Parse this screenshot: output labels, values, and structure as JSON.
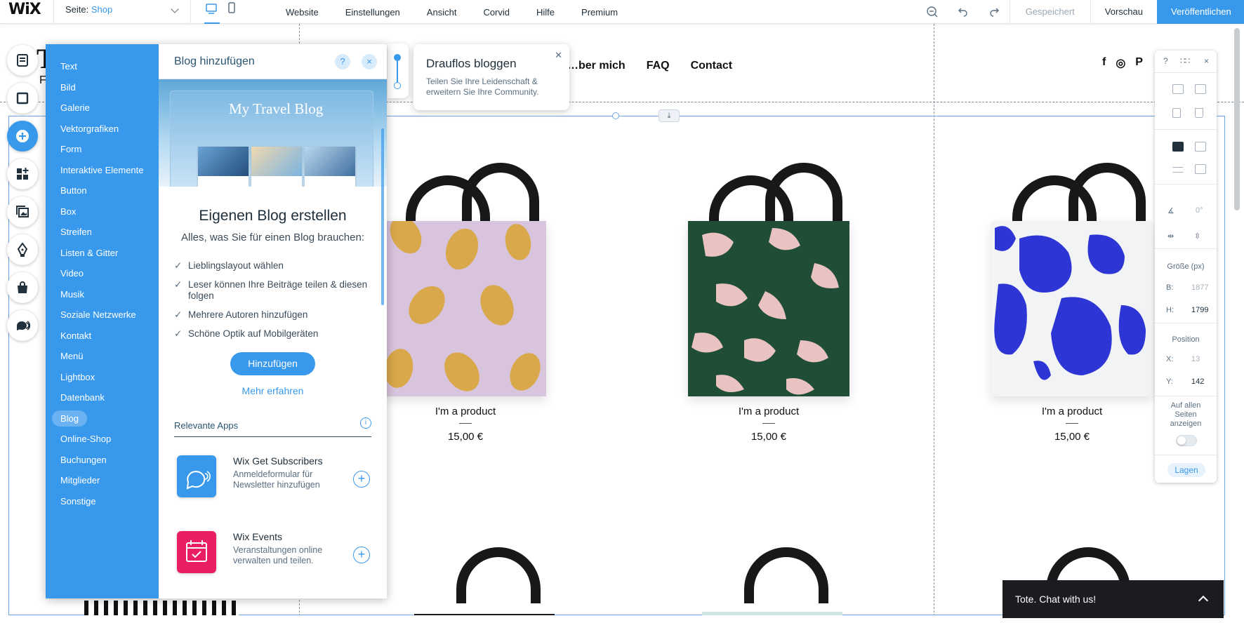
{
  "topbar": {
    "logo": "WiX",
    "page_label": "Seite:",
    "page_value": "Shop",
    "menu": [
      "Website",
      "Einstellungen",
      "Ansicht",
      "Corvid",
      "Hilfe",
      "Premium"
    ],
    "saved": "Gespeichert",
    "preview": "Vorschau",
    "publish": "Veröffentlichen"
  },
  "rail": [
    "pages-icon",
    "background-icon",
    "add-icon",
    "app-market-icon",
    "media-icon",
    "pen-icon",
    "bag-icon",
    "chat-icon"
  ],
  "add_panel": {
    "categories": [
      "Text",
      "Bild",
      "Galerie",
      "Vektorgrafiken",
      "Form",
      "Interaktive Elemente",
      "Button",
      "Box",
      "Streifen",
      "Listen & Gitter",
      "Video",
      "Musik",
      "Soziale Netzwerke",
      "Kontakt",
      "Menü",
      "Lightbox",
      "Datenbank",
      "Blog",
      "Online-Shop",
      "Buchungen",
      "Mitglieder",
      "Sonstige"
    ],
    "selected": "Blog",
    "title": "Blog hinzufügen",
    "help": "?",
    "close": "×",
    "preview_title": "My Travel Blog",
    "heading": "Eigenen Blog erstellen",
    "subheading": "Alles, was Sie für einen Blog brauchen:",
    "features": [
      "Lieblingslayout wählen",
      "Leser können Ihre Beiträge teilen & diesen folgen",
      "Mehrere Autoren hinzufügen",
      "Schöne Optik auf Mobilgeräten"
    ],
    "add_button": "Hinzufügen",
    "learn_more": "Mehr erfahren",
    "relevant_apps": "Relevante Apps",
    "apps": [
      {
        "name": "Wix Get Subscribers",
        "desc": "Anmeldeformular für Newsletter hinzufügen",
        "color": "#3899ec"
      },
      {
        "name": "Wix Events",
        "desc": "Veranstaltungen online verwalten und teilen.",
        "color": "#e91e63"
      }
    ]
  },
  "tooltip": {
    "title": "Drauflos bloggen",
    "text": "Teilen Sie Ihre Leidenschaft & erweitern Sie Ihre Community."
  },
  "site": {
    "nav": [
      "…ber mich",
      "FAQ",
      "Contact"
    ],
    "products": [
      {
        "name": "I'm a product",
        "price": "15,00 €"
      },
      {
        "name": "I'm a product",
        "price": "15,00 €"
      },
      {
        "name": "I'm a product",
        "price": "15,00 €"
      }
    ],
    "chat": "Tote. Chat with us!"
  },
  "inspector": {
    "help": "?",
    "close": "×",
    "angle": "0°",
    "size_label": "Größe (px)",
    "w_label": "B:",
    "w_value": "1877",
    "h_label": "H:",
    "h_value": "1799",
    "position_label": "Position",
    "x_label": "X:",
    "x_value": "13",
    "y_label": "Y:",
    "y_value": "142",
    "all_pages": "Auf allen Seiten anzeigen",
    "layers": "Lagen"
  }
}
